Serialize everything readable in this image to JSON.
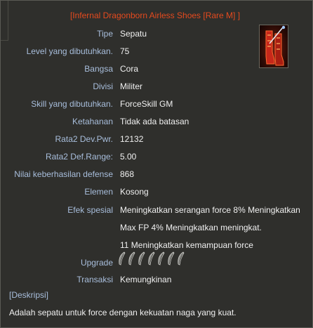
{
  "title": "[Infernal Dragonborn Airless Shoes [Rare M] ]",
  "icon": "red-armored-boots-icon",
  "stats": [
    {
      "label": "Tipe",
      "value": "Sepatu"
    },
    {
      "label": "Level yang dibutuhkan.",
      "value": "75"
    },
    {
      "label": "Bangsa",
      "value": "Cora"
    },
    {
      "label": "Divisi",
      "value": "Militer"
    },
    {
      "label": "Skill yang dibutuhkan.",
      "value": "ForceSkill GM"
    },
    {
      "label": "Ketahanan",
      "value": "Tidak ada batasan"
    },
    {
      "label": "Rata2 Dev.Pwr.",
      "value": "12132"
    },
    {
      "label": "Rata2 Def.Range:",
      "value": "5.00"
    },
    {
      "label": "Nilai keberhasilan defense",
      "value": "868"
    },
    {
      "label": "Elemen",
      "value": "Kosong"
    },
    {
      "label": "Efek spesial",
      "value": "Meningkatkan serangan force 8% Meningkatkan"
    }
  ],
  "effect_lines": [
    "Max FP 4% Meningkatkan meningkat.",
    "11 Meningkatkan kemampuan force"
  ],
  "upgrade": {
    "label": "Upgrade",
    "slots": 7,
    "slot_icon": "feather-slot-icon"
  },
  "transaction": {
    "label": "Transaksi",
    "value": "Kemungkinan"
  },
  "description": {
    "heading": "[Deskripsi]",
    "text": "Adalah sepatu untuk force dengan kekuatan naga yang kuat."
  },
  "colors": {
    "title": "#e54a1e",
    "label": "#a8bedc",
    "value": "#f0f0f0",
    "background": "#2f2f2c"
  }
}
